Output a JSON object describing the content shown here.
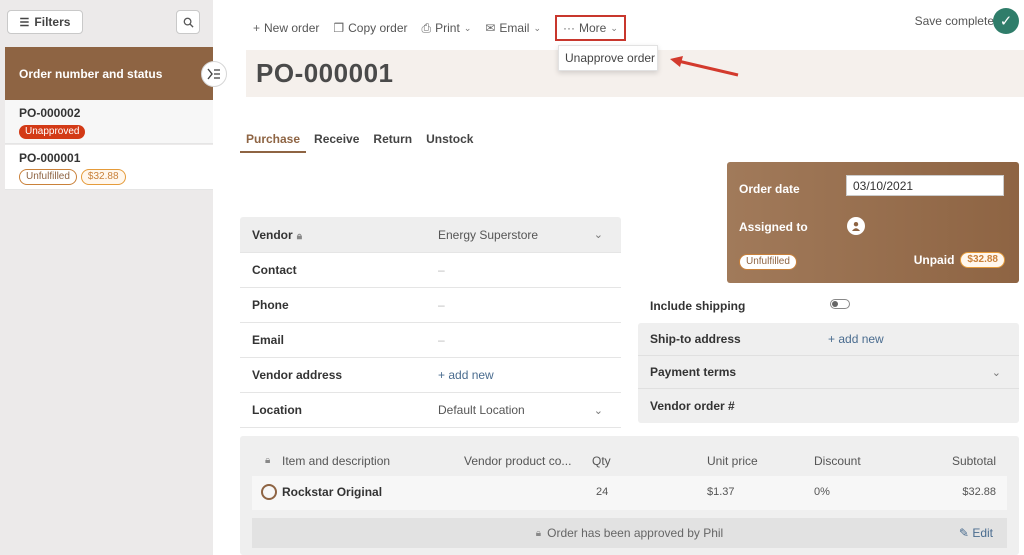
{
  "sidebar": {
    "filters_label": "Filters",
    "list_header": "Order number and status",
    "orders": [
      {
        "number": "PO-000002",
        "status": "Unapproved",
        "amount": ""
      },
      {
        "number": "PO-000001",
        "status": "Unfulfilled",
        "amount": "$32.88"
      }
    ]
  },
  "toolbar": {
    "new_order": "New order",
    "copy_order": "Copy order",
    "print": "Print",
    "email": "Email",
    "more": "More",
    "more_menu": [
      "Unapprove order"
    ],
    "save_status": "Save complete"
  },
  "order": {
    "title": "PO-000001",
    "tabs": [
      "Purchase",
      "Receive",
      "Return",
      "Unstock"
    ],
    "active_tab": "Purchase"
  },
  "vendor_fields": [
    {
      "label": "Vendor",
      "value": "Energy Superstore"
    },
    {
      "label": "Contact",
      "value": "–"
    },
    {
      "label": "Phone",
      "value": "–"
    },
    {
      "label": "Email",
      "value": "–"
    },
    {
      "label": "Vendor address",
      "value": "+ add new"
    },
    {
      "label": "Location",
      "value": "Default Location"
    }
  ],
  "summary": {
    "order_date_label": "Order date",
    "order_date_value": "03/10/2021",
    "assigned_label": "Assigned to",
    "fulfillment_status": "Unfulfilled",
    "payment_status": "Unpaid",
    "payment_amount": "$32.88"
  },
  "shipping": {
    "include_label": "Include shipping",
    "include_enabled": false,
    "ship_to_label": "Ship-to address",
    "ship_to_value": "+ add new",
    "payment_terms_label": "Payment terms",
    "vendor_order_label": "Vendor order #"
  },
  "items_table": {
    "headers": [
      "Item and description",
      "Vendor product co...",
      "Qty",
      "Unit price",
      "Discount",
      "Subtotal"
    ],
    "rows": [
      {
        "name": "Rockstar Original",
        "vendor_code": "",
        "qty": "24",
        "unit_price": "$1.37",
        "discount": "0%",
        "subtotal": "$32.88"
      }
    ],
    "approval_note": "Order has been approved by Phil",
    "edit_label": "Edit"
  },
  "colors": {
    "brand_brown": "#8e6443",
    "danger_red": "#d33a16",
    "success_green": "#2f7d6a",
    "link_blue": "#4a6c8f"
  }
}
